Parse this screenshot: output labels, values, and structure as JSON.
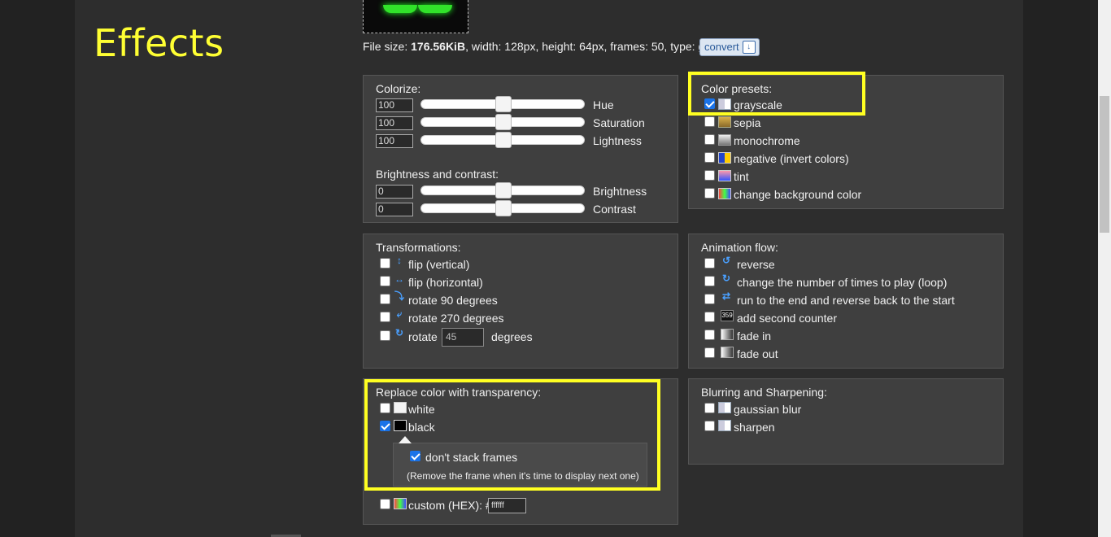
{
  "page_title": "Effects",
  "file_info": {
    "prefix": "File size:",
    "size": "176.56KiB",
    "rest": ", width: 128px, height: 64px, frames: 50, type: gif",
    "convert_label": "convert"
  },
  "colorize": {
    "title": "Colorize:",
    "hue": {
      "value": "100",
      "label": "Hue",
      "level": 0.5
    },
    "saturation": {
      "value": "100",
      "label": "Saturation",
      "level": 0.5
    },
    "lightness": {
      "value": "100",
      "label": "Lightness",
      "level": 0.5
    }
  },
  "brightness_contrast": {
    "title": "Brightness and contrast:",
    "brightness": {
      "value": "0",
      "label": "Brightness",
      "level": 0.5
    },
    "contrast": {
      "value": "0",
      "label": "Contrast",
      "level": 0.5
    }
  },
  "color_presets": {
    "title": "Color presets:",
    "items": [
      {
        "label": "grayscale",
        "checked": true
      },
      {
        "label": "sepia",
        "checked": false
      },
      {
        "label": "monochrome",
        "checked": false
      },
      {
        "label": "negative (invert colors)",
        "checked": false
      },
      {
        "label": "tint",
        "checked": false
      },
      {
        "label": "change background color",
        "checked": false
      }
    ]
  },
  "transformations": {
    "title": "Transformations:",
    "items": [
      {
        "label": "flip (vertical)",
        "icon": "flip-vertical-icon"
      },
      {
        "label": "flip (horizontal)",
        "icon": "flip-horizontal-icon"
      },
      {
        "label": "rotate 90 degrees",
        "icon": "rotate-90-icon"
      },
      {
        "label": "rotate 270 degrees",
        "icon": "rotate-270-icon"
      }
    ],
    "rotate_label": "rotate",
    "rotate_value": "45",
    "degrees_label": "degrees"
  },
  "animation_flow": {
    "title": "Animation flow:",
    "items": [
      {
        "label": "reverse"
      },
      {
        "label": "change the number of times to play (loop)"
      },
      {
        "label": "run to the end and reverse back to the start"
      },
      {
        "label": "add second counter"
      },
      {
        "label": "fade in"
      },
      {
        "label": "fade out"
      }
    ],
    "counter_icon_text": "359"
  },
  "transparency": {
    "title": "Replace color with transparency:",
    "white_label": "white",
    "black_label": "black",
    "white_checked": false,
    "black_checked": true,
    "dont_stack_label": "don't stack frames",
    "dont_stack_checked": true,
    "dont_stack_note": "(Remove the frame when it's time to display next one)",
    "custom_label": "custom (HEX): #",
    "custom_value": "ffffff"
  },
  "blur_sharpen": {
    "title": "Blurring and Sharpening:",
    "items": [
      {
        "label": "gaussian blur"
      },
      {
        "label": "sharpen"
      }
    ]
  },
  "colors": {
    "accent_yellow": "#ffff22",
    "checkbox_blue": "#1a73e8",
    "preview_green": "#31e22a"
  }
}
